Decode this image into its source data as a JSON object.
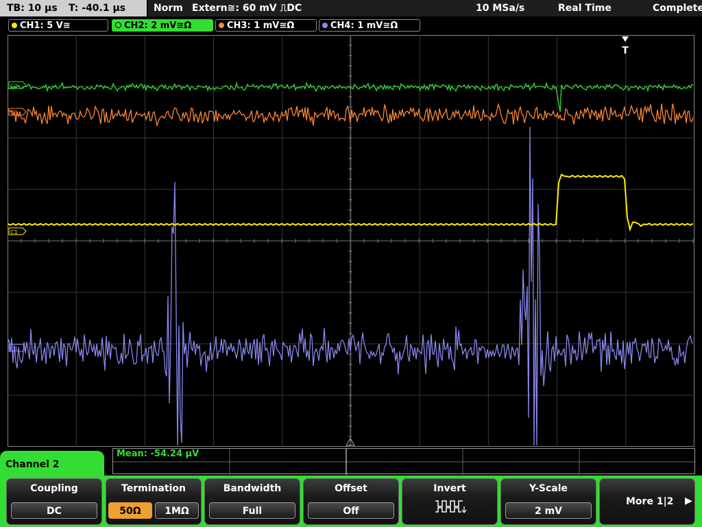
{
  "status": {
    "timebase": "TB: 10 µs",
    "trigger_time": "T: -40.1 µs",
    "mode": "Norm",
    "trigger_source": "Extern≅: 60 mV ⎍DC",
    "sample_rate": "10 MSa/s",
    "acq_mode": "Real Time",
    "acq_state": "Complete"
  },
  "channels": [
    {
      "label": "CH1: 5 V≅",
      "color": "#ffee00",
      "active": false
    },
    {
      "label": "CH2: 2 mV≅Ω",
      "color": "#33dd33",
      "active": true
    },
    {
      "label": "CH3: 1 mV≅Ω",
      "color": "#ff8833",
      "active": false
    },
    {
      "label": "CH4: 1 mV≅Ω",
      "color": "#8888ee",
      "active": false
    }
  ],
  "markers": {
    "trigger": "T",
    "ch1": "C1",
    "ch2": "C2",
    "ch3": "C3",
    "ch4": "C4"
  },
  "measurement": "Mean: -54.24 µV",
  "menu": {
    "title": "Channel 2",
    "coupling": {
      "title": "Coupling",
      "value": "DC"
    },
    "termination": {
      "title": "Termination",
      "options": [
        "50Ω",
        "1MΩ"
      ],
      "selected": "50Ω"
    },
    "bandwidth": {
      "title": "Bandwidth",
      "value": "Full"
    },
    "offset": {
      "title": "Offset",
      "value": "Off"
    },
    "invert": {
      "title": "Invert",
      "icon": "inverted-square-wave-icon"
    },
    "yscale": {
      "title": "Y-Scale",
      "value": "2 mV"
    },
    "more": {
      "label": "More 1|2"
    }
  }
}
